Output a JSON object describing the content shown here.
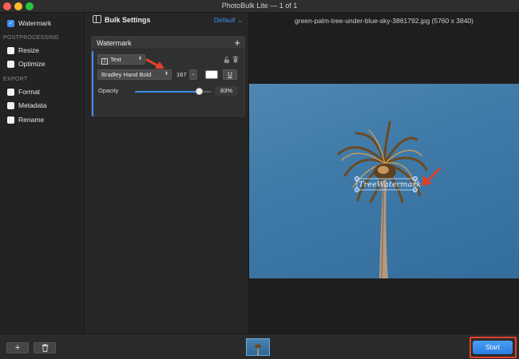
{
  "window": {
    "title": "PhotoBulk Lite — 1 of 1"
  },
  "sidebar": {
    "watermark": {
      "label": "Watermark",
      "checked": true
    },
    "postprocessing_header": "POSTPROCESSING",
    "resize": {
      "label": "Resize",
      "checked": false
    },
    "optimize": {
      "label": "Optimize",
      "checked": false
    },
    "export_header": "EXPORT",
    "format": {
      "label": "Format",
      "checked": false
    },
    "metadata": {
      "label": "Metadata",
      "checked": false
    },
    "rename": {
      "label": "Rename",
      "checked": false
    }
  },
  "settings": {
    "title": "Bulk Settings",
    "preset": "Default ⌄",
    "watermark_card": {
      "title": "Watermark",
      "add_icon": "plus-icon",
      "type_select": "Text",
      "font_select": "Bradley Hand Bold",
      "font_size": "167",
      "font_size_stepper": "⌄",
      "text_color": "#ffffff",
      "underline_label": "U",
      "opacity_label": "Opacity",
      "opacity_value": "83%",
      "opacity_fraction": 0.83
    }
  },
  "preview": {
    "filename": "green-palm-tree-under-blue-sky-3861792.jpg (5760 x 3840)",
    "watermark_text": "TreeWatermark"
  },
  "bottom": {
    "add_label": "+",
    "start_label": "Start"
  },
  "colors": {
    "accent": "#3b8fef",
    "annotation": "#e0402a"
  }
}
